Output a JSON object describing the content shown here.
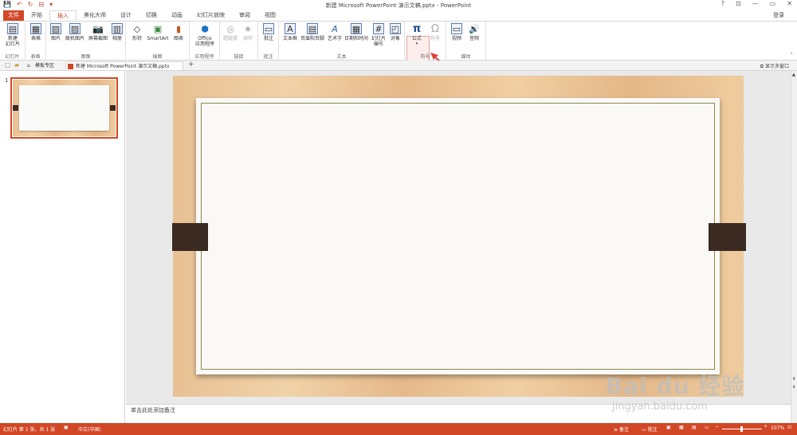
{
  "window": {
    "title": "新建 Microsoft PowerPoint 演示文稿.pptx - PowerPoint",
    "controls": [
      "?",
      "⊡",
      "—",
      "▭",
      "✕"
    ]
  },
  "qat": [
    "💾",
    "↶",
    "↻",
    "⊟",
    "▾"
  ],
  "ribbon_tabs": [
    "文件",
    "开始",
    "插入",
    "美化大师",
    "设计",
    "切换",
    "动画",
    "幻灯片放映",
    "审阅",
    "视图"
  ],
  "active_tab": "插入",
  "user": "登录",
  "ribbon": {
    "groups": [
      {
        "label": "幻灯片",
        "buttons": [
          "新建\n幻灯片"
        ]
      },
      {
        "label": "表格",
        "buttons": [
          "表格"
        ]
      },
      {
        "label": "图像",
        "buttons": [
          "图片",
          "联机图片",
          "屏幕截图",
          "相册"
        ]
      },
      {
        "label": "插图",
        "buttons": [
          "形状",
          "SmartArt",
          "图表"
        ]
      },
      {
        "label": "应用程序",
        "buttons": [
          "Office\n应用程序"
        ]
      },
      {
        "label": "链接",
        "buttons": [
          "超链接",
          "动作"
        ]
      },
      {
        "label": "批注",
        "buttons": [
          "批注"
        ]
      },
      {
        "label": "文本",
        "buttons": [
          "文本框",
          "页眉和页脚",
          "艺术字",
          "日期和时间",
          "幻灯片\n编号",
          "对象"
        ]
      },
      {
        "label": "符号",
        "buttons": [
          "公式",
          "符号"
        ]
      },
      {
        "label": "媒体",
        "buttons": [
          "视频",
          "音频"
        ]
      }
    ]
  },
  "doc_tabs": [
    "模板专区",
    "新建 Microsoft PowerPoint 演示文稿.pptx"
  ],
  "doc_tab_extra": "显示多窗口",
  "thumbnail_number": "1",
  "notes_placeholder": "单击此处添加备注",
  "status": {
    "slide_info": "幻灯片 第 1 张，共 1 张",
    "language": "中文(中国)",
    "notes_label": "备注",
    "comments_label": "批注",
    "zoom": "107%"
  },
  "watermark": {
    "brand": "Bai du 经验",
    "url": "jingyan.baidu.com"
  }
}
